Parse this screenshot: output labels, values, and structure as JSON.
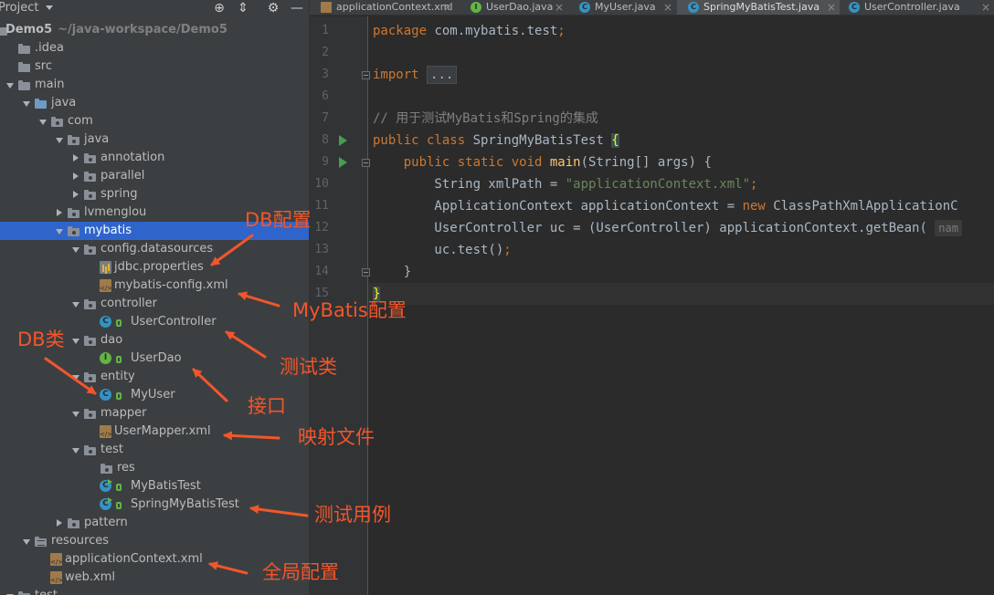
{
  "project_panel": {
    "title": "Project",
    "tree": [
      {
        "label": "Demo5",
        "extra": "~/java-workspace/Demo5",
        "kind": "module",
        "depth": 0,
        "state": "open"
      },
      {
        "label": ".idea",
        "kind": "folder",
        "depth": 1,
        "state": "none"
      },
      {
        "label": "src",
        "kind": "folder",
        "depth": 1,
        "state": "none"
      },
      {
        "label": "main",
        "kind": "folder",
        "depth": 1,
        "state": "open"
      },
      {
        "label": "java",
        "kind": "src",
        "depth": 2,
        "state": "open"
      },
      {
        "label": "com",
        "kind": "pkg",
        "depth": 3,
        "state": "open"
      },
      {
        "label": "java",
        "kind": "pkg",
        "depth": 4,
        "state": "open"
      },
      {
        "label": "annotation",
        "kind": "pkg",
        "depth": 5,
        "state": "closed"
      },
      {
        "label": "parallel",
        "kind": "pkg",
        "depth": 5,
        "state": "closed"
      },
      {
        "label": "spring",
        "kind": "pkg",
        "depth": 5,
        "state": "closed"
      },
      {
        "label": "lvmenglou",
        "kind": "pkg",
        "depth": 4,
        "state": "closed"
      },
      {
        "label": "mybatis",
        "kind": "pkg",
        "depth": 4,
        "state": "open",
        "selected": true
      },
      {
        "label": "config.datasources",
        "kind": "pkg",
        "depth": 5,
        "state": "open"
      },
      {
        "label": "jdbc.properties",
        "kind": "prop",
        "depth": 6,
        "state": "none"
      },
      {
        "label": "mybatis-config.xml",
        "kind": "xml",
        "depth": 6,
        "state": "none"
      },
      {
        "label": "controller",
        "kind": "pkg",
        "depth": 5,
        "state": "open"
      },
      {
        "label": "UserController",
        "kind": "class",
        "depth": 6,
        "state": "none"
      },
      {
        "label": "dao",
        "kind": "pkg",
        "depth": 5,
        "state": "open"
      },
      {
        "label": "UserDao",
        "kind": "interface",
        "depth": 6,
        "state": "none"
      },
      {
        "label": "entity",
        "kind": "pkg",
        "depth": 5,
        "state": "open"
      },
      {
        "label": "MyUser",
        "kind": "class",
        "depth": 6,
        "state": "none"
      },
      {
        "label": "mapper",
        "kind": "pkg",
        "depth": 5,
        "state": "open"
      },
      {
        "label": "UserMapper.xml",
        "kind": "xml",
        "depth": 6,
        "state": "none"
      },
      {
        "label": "test",
        "kind": "pkg",
        "depth": 5,
        "state": "open"
      },
      {
        "label": "res",
        "kind": "pkg",
        "depth": 6,
        "state": "none"
      },
      {
        "label": "MyBatisTest",
        "kind": "testclass",
        "depth": 6,
        "state": "none"
      },
      {
        "label": "SpringMyBatisTest",
        "kind": "testclass",
        "depth": 6,
        "state": "none"
      },
      {
        "label": "pattern",
        "kind": "pkg",
        "depth": 4,
        "state": "closed"
      },
      {
        "label": "resources",
        "kind": "res",
        "depth": 2,
        "state": "open"
      },
      {
        "label": "applicationContext.xml",
        "kind": "xml",
        "depth": 3,
        "state": "none"
      },
      {
        "label": "web.xml",
        "kind": "xml",
        "depth": 3,
        "state": "none"
      },
      {
        "label": "test",
        "kind": "folder",
        "depth": 1,
        "state": "open"
      }
    ]
  },
  "tabs": [
    {
      "label": "applicationContext.xml",
      "icon": "xml-file-icon",
      "active": false
    },
    {
      "label": "UserDao.java",
      "icon": "interface-icon",
      "active": false
    },
    {
      "label": "MyUser.java",
      "icon": "class-icon",
      "active": false
    },
    {
      "label": "SpringMyBatisTest.java",
      "icon": "class-icon",
      "active": true
    },
    {
      "label": "UserController.java",
      "icon": "class-icon",
      "active": false
    }
  ],
  "editor": {
    "lines": [
      {
        "n": "1",
        "tokens": [
          [
            "kw",
            "package "
          ],
          [
            "t",
            "com.mybatis.test"
          ],
          [
            "kw",
            ";"
          ]
        ]
      },
      {
        "n": "2",
        "tokens": []
      },
      {
        "n": "3",
        "tokens": [
          [
            "kw",
            "import "
          ],
          [
            "collapsed",
            "..."
          ]
        ]
      },
      {
        "n": "6",
        "tokens": []
      },
      {
        "n": "7",
        "tokens": [
          [
            "cmt",
            "// 用于测试MyBatis和Spring的集成"
          ]
        ]
      },
      {
        "n": "8",
        "tokens": [
          [
            "kw",
            "public class "
          ],
          [
            "t",
            "SpringMyBatisTest "
          ],
          [
            "hl",
            "{"
          ]
        ],
        "run": true
      },
      {
        "n": "9",
        "tokens": [
          [
            "t",
            "    "
          ],
          [
            "kw",
            "public static void "
          ],
          [
            "fn",
            "main"
          ],
          [
            "t",
            "(String[] args) {"
          ]
        ],
        "run": true,
        "fold": true
      },
      {
        "n": "10",
        "tokens": [
          [
            "t",
            "        String xmlPath = "
          ],
          [
            "str",
            "\"applicationContext.xml\""
          ],
          [
            "kw",
            ";"
          ]
        ]
      },
      {
        "n": "11",
        "tokens": [
          [
            "t",
            "        ApplicationContext applicationContext = "
          ],
          [
            "kw",
            "new "
          ],
          [
            "t",
            "ClassPathXmlApplicationC"
          ]
        ]
      },
      {
        "n": "12",
        "tokens": [
          [
            "t",
            "        UserController uc = (UserController) applicationContext.getBean( "
          ],
          [
            "hint",
            "nam"
          ]
        ]
      },
      {
        "n": "13",
        "tokens": [
          [
            "t",
            "        uc.test()"
          ],
          [
            "kw",
            ";"
          ]
        ]
      },
      {
        "n": "14",
        "tokens": [
          [
            "t",
            "    }"
          ]
        ],
        "fold": true
      },
      {
        "n": "15",
        "tokens": [
          [
            "hl",
            "}"
          ]
        ]
      }
    ]
  },
  "annotations": {
    "db_config": "DB配置",
    "mybatis_config": "MyBatis配置",
    "db_class": "DB类",
    "test_class": "测试类",
    "interface": "接口",
    "mapping_file": "映射文件",
    "test_case": "测试用例",
    "global_config": "全局配置"
  },
  "colors": {
    "annotation": "#f2562b",
    "selection": "#2f65ca",
    "keyword": "#cc7832",
    "string": "#6a8759"
  }
}
